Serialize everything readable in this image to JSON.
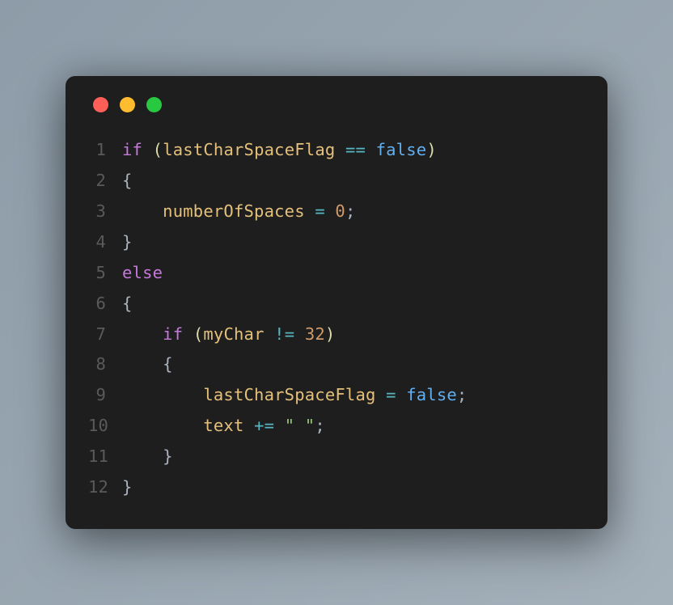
{
  "traffic_lights": {
    "red": "close",
    "yellow": "minimize",
    "green": "maximize"
  },
  "code": {
    "lines": [
      {
        "num": "1",
        "tokens": [
          {
            "cls": "kw",
            "t": "if"
          },
          {
            "cls": "",
            "t": " "
          },
          {
            "cls": "paren",
            "t": "("
          },
          {
            "cls": "var",
            "t": "lastCharSpaceFlag"
          },
          {
            "cls": "",
            "t": " "
          },
          {
            "cls": "op",
            "t": "=="
          },
          {
            "cls": "",
            "t": " "
          },
          {
            "cls": "bool",
            "t": "false"
          },
          {
            "cls": "paren",
            "t": ")"
          }
        ]
      },
      {
        "num": "2",
        "tokens": [
          {
            "cls": "brace",
            "t": "{"
          }
        ]
      },
      {
        "num": "3",
        "tokens": [
          {
            "cls": "",
            "t": "    "
          },
          {
            "cls": "var",
            "t": "numberOfSpaces"
          },
          {
            "cls": "",
            "t": " "
          },
          {
            "cls": "op",
            "t": "="
          },
          {
            "cls": "",
            "t": " "
          },
          {
            "cls": "num",
            "t": "0"
          },
          {
            "cls": "punct",
            "t": ";"
          }
        ]
      },
      {
        "num": "4",
        "tokens": [
          {
            "cls": "brace",
            "t": "}"
          }
        ]
      },
      {
        "num": "5",
        "tokens": [
          {
            "cls": "kw",
            "t": "else"
          }
        ]
      },
      {
        "num": "6",
        "tokens": [
          {
            "cls": "brace",
            "t": "{"
          }
        ]
      },
      {
        "num": "7",
        "tokens": [
          {
            "cls": "",
            "t": "    "
          },
          {
            "cls": "kw",
            "t": "if"
          },
          {
            "cls": "",
            "t": " "
          },
          {
            "cls": "paren",
            "t": "("
          },
          {
            "cls": "var",
            "t": "myChar"
          },
          {
            "cls": "",
            "t": " "
          },
          {
            "cls": "op",
            "t": "!="
          },
          {
            "cls": "",
            "t": " "
          },
          {
            "cls": "num",
            "t": "32"
          },
          {
            "cls": "paren",
            "t": ")"
          }
        ]
      },
      {
        "num": "8",
        "tokens": [
          {
            "cls": "",
            "t": "    "
          },
          {
            "cls": "brace",
            "t": "{"
          }
        ]
      },
      {
        "num": "9",
        "tokens": [
          {
            "cls": "",
            "t": "        "
          },
          {
            "cls": "var",
            "t": "lastCharSpaceFlag"
          },
          {
            "cls": "",
            "t": " "
          },
          {
            "cls": "op",
            "t": "="
          },
          {
            "cls": "",
            "t": " "
          },
          {
            "cls": "bool",
            "t": "false"
          },
          {
            "cls": "punct",
            "t": ";"
          }
        ]
      },
      {
        "num": "10",
        "tokens": [
          {
            "cls": "",
            "t": "        "
          },
          {
            "cls": "var",
            "t": "text"
          },
          {
            "cls": "",
            "t": " "
          },
          {
            "cls": "op",
            "t": "+="
          },
          {
            "cls": "",
            "t": " "
          },
          {
            "cls": "str",
            "t": "\" \""
          },
          {
            "cls": "punct",
            "t": ";"
          }
        ]
      },
      {
        "num": "11",
        "tokens": [
          {
            "cls": "",
            "t": "    "
          },
          {
            "cls": "brace",
            "t": "}"
          }
        ]
      },
      {
        "num": "12",
        "tokens": [
          {
            "cls": "brace",
            "t": "}"
          }
        ]
      }
    ]
  }
}
